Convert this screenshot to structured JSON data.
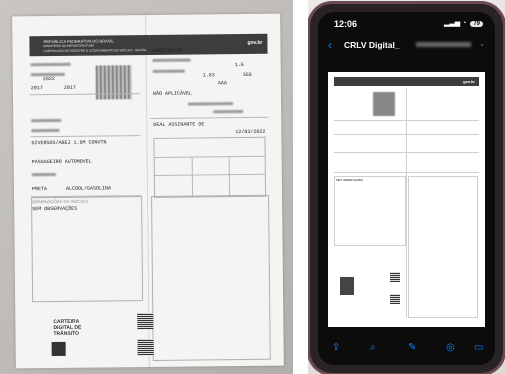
{
  "paper_doc": {
    "republic": "REPÚBLICA FEDERATIVA DO BRASIL",
    "ministry": "MINISTÉRIO DA INFRAESTRUTURA",
    "doc_title": "CERTIFICADO DE REGISTRO E LICENCIAMENTO DE VEÍCULO - DIGITAL",
    "gov": "gov.br",
    "especie": "PARTICULAR",
    "year_fab": "2022",
    "year_mod": "2017",
    "year_mod2": "2017",
    "potencia": "1.6",
    "ocupantes": "1.63",
    "peso": "356",
    "combustivel_code": "AAA",
    "category": "NÃO APLICÁVEL",
    "marca": "DIVERSOS/ABEJ 1.6M CONVTN",
    "especie_tipo": "PASSAGEIRO AUTOMOVEL",
    "cor": "PRETA",
    "combustivel": "ALCOOL/GASOLINA",
    "local": "DEAL ASSINANTE DE",
    "data": "12/03/2022",
    "obs_title": "OBSERVAÇÕES DO VEÍCULO",
    "obs_text": "SEM OBSERVAÇÕES",
    "card_title_1": "CARTEIRA",
    "card_title_2": "DIGITAL DE",
    "card_title_3": "TRÂNSITO"
  },
  "phone": {
    "time": "12:06",
    "battery": "79",
    "nav_title": "CRLV Digital_",
    "pdf_obs": "SEM OBSERVAÇÕES"
  },
  "colors": {
    "phone_case": "#6b4a55",
    "ios_blue": "#0a84ff",
    "header_dark": "#3d3d3d"
  }
}
